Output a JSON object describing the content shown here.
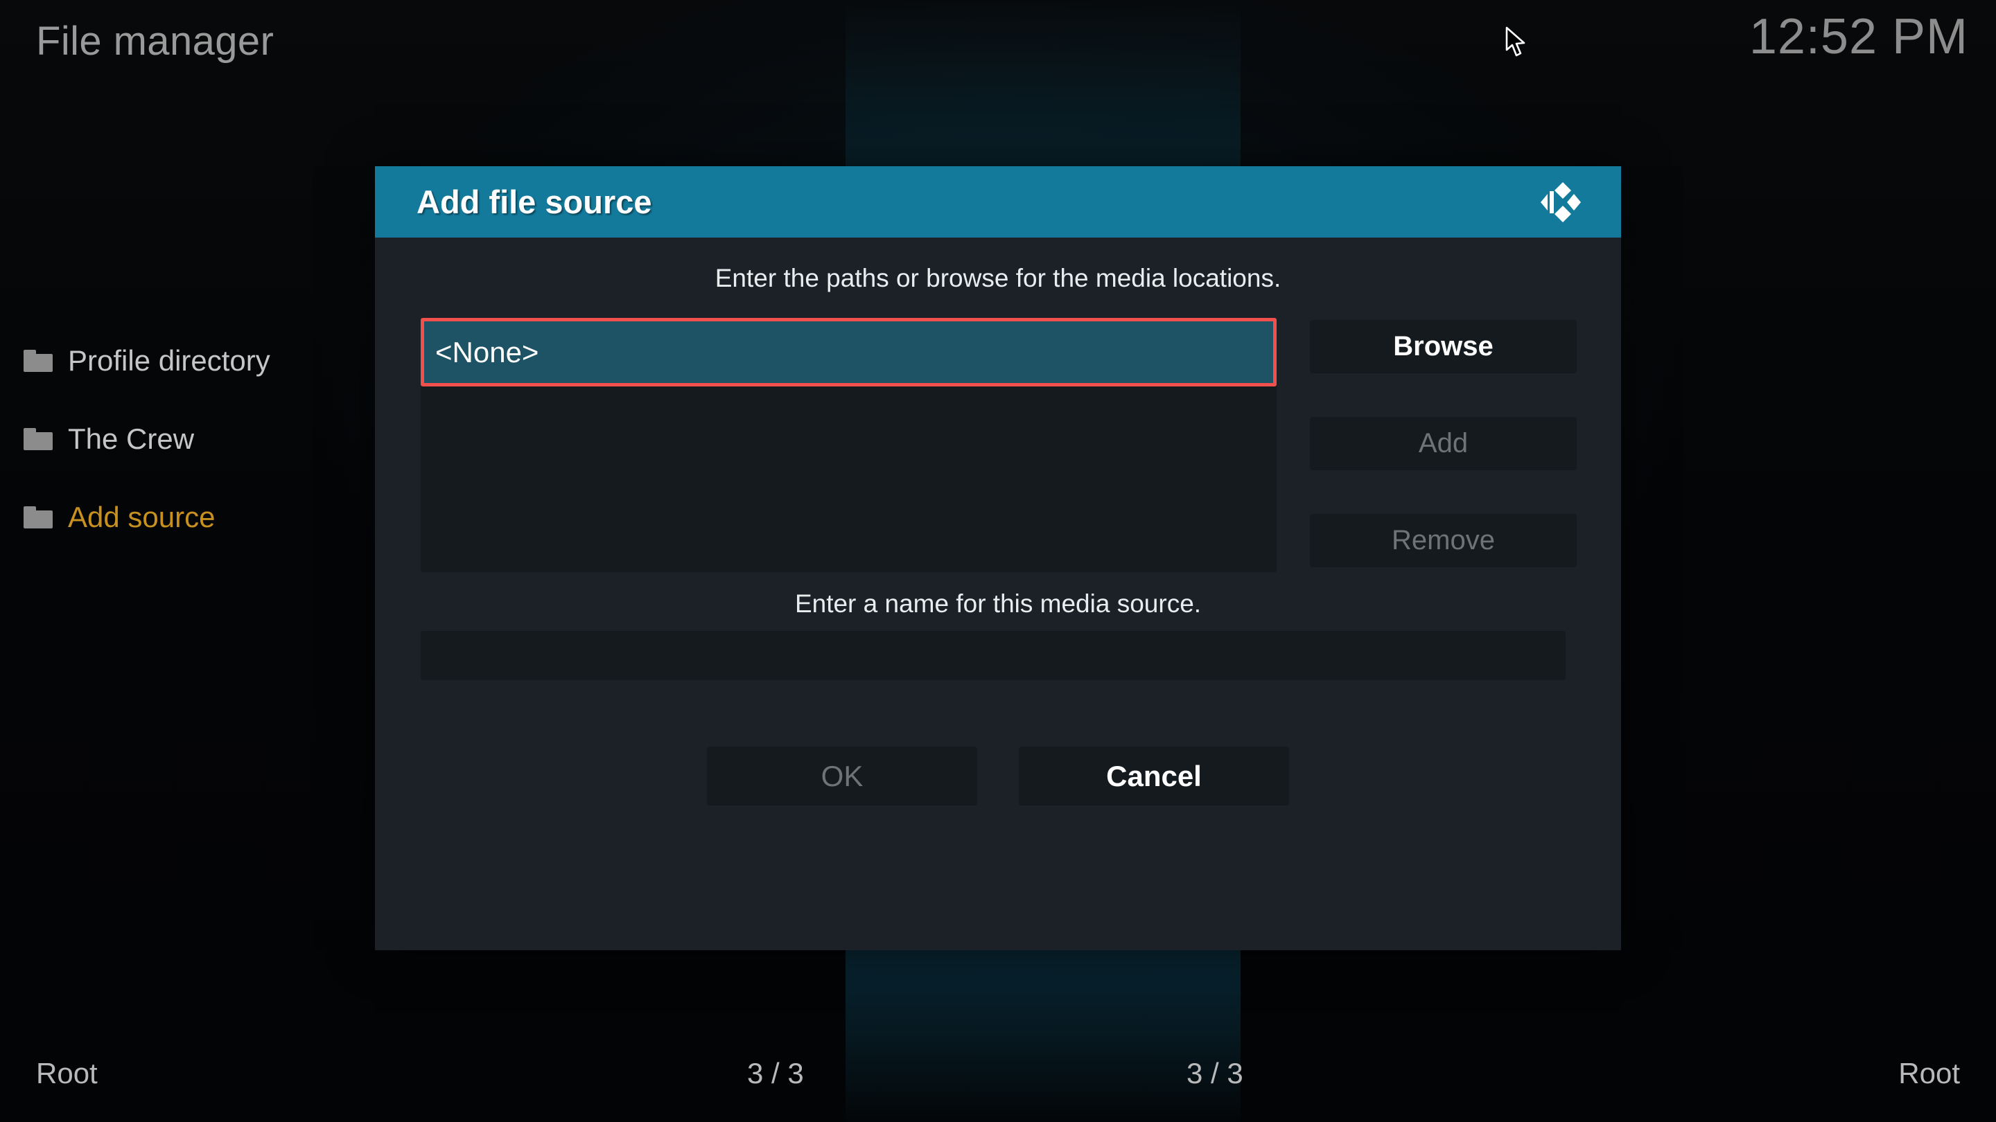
{
  "header": {
    "title": "File manager",
    "clock": "12:52 PM"
  },
  "file_list": {
    "items": [
      {
        "label": "Profile directory",
        "icon": "folder-icon",
        "accent": false
      },
      {
        "label": "The Crew",
        "icon": "folder-icon",
        "accent": false
      },
      {
        "label": "Add source",
        "icon": "folder-icon",
        "accent": true
      }
    ]
  },
  "dialog": {
    "title": "Add file source",
    "logo_icon": "kodi-logo-icon",
    "path_hint": "Enter the paths or browse for the media locations.",
    "paths": [
      {
        "value": "<None>",
        "focused": true
      }
    ],
    "side_buttons": [
      {
        "label": "Browse",
        "enabled": true
      },
      {
        "label": "Add",
        "enabled": false
      },
      {
        "label": "Remove",
        "enabled": false
      }
    ],
    "name_hint": "Enter a name for this media source.",
    "name_input": {
      "value": "",
      "placeholder": ""
    },
    "actions": [
      {
        "label": "OK",
        "enabled": false
      },
      {
        "label": "Cancel",
        "enabled": true
      }
    ]
  },
  "status_bar": {
    "left_path": "Root",
    "left_count": "3 / 3",
    "right_count": "3 / 3",
    "right_path": "Root"
  },
  "colors": {
    "dialog_header": "#137a9c",
    "focus_border": "#f2504d",
    "focus_fill": "#1d5365",
    "accent_text": "#c8911f",
    "dialog_bg": "#1b2126",
    "control_bg": "#141a1d"
  },
  "cursor": {
    "icon": "arrow-cursor-icon"
  }
}
